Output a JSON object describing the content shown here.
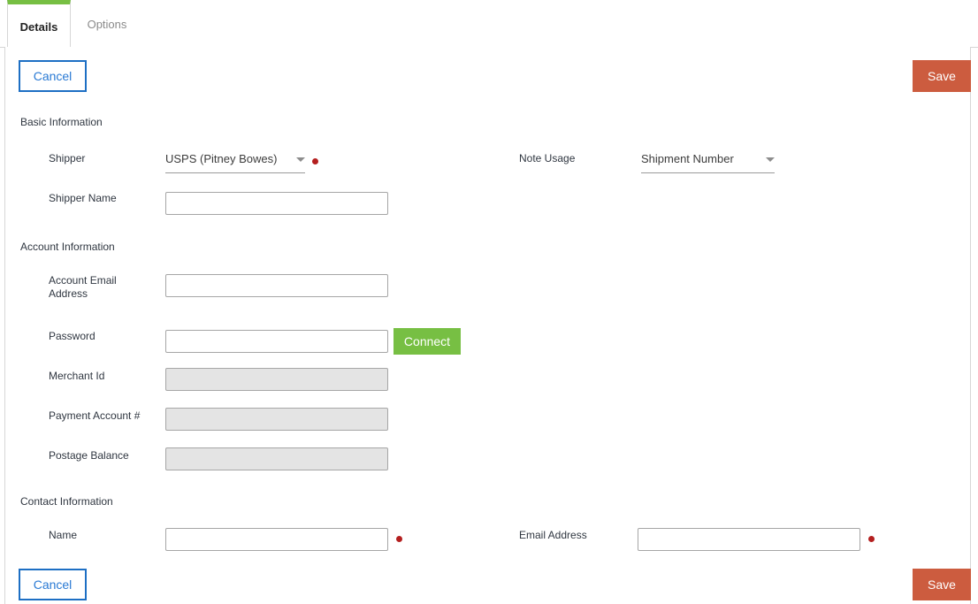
{
  "tabs": [
    {
      "label": "Details",
      "active": true
    },
    {
      "label": "Options",
      "active": false
    }
  ],
  "toolbar": {
    "cancel_label": "Cancel",
    "save_label": "Save"
  },
  "colors": {
    "accent_green": "#77bf43",
    "save_button": "#cc5c3f",
    "cancel_border": "#1d6fc4",
    "cancel_text": "#2a7ad4",
    "required_dot": "#b41f1f",
    "label_text": "#2f3640",
    "panel_border": "#d6d6d6",
    "input_border": "#a6a6a6",
    "disabled_field": "#e4e4e4"
  },
  "sections": {
    "basic": {
      "heading": "Basic Information"
    },
    "account": {
      "heading": "Account Information"
    },
    "contact": {
      "heading": "Contact Information"
    }
  },
  "fields": {
    "shipper": {
      "label": "Shipper",
      "value": "USPS (Pitney Bowes)",
      "required": true,
      "control": "dropdown"
    },
    "note_usage": {
      "label": "Note Usage",
      "value": "Shipment Number",
      "required": false,
      "control": "dropdown"
    },
    "shipper_name": {
      "label": "Shipper Name",
      "value": "",
      "placeholder": "",
      "required": false,
      "control": "text"
    },
    "account_email": {
      "label": "Account Email Address",
      "value": "",
      "placeholder": "",
      "required": false,
      "control": "text"
    },
    "password": {
      "label": "Password",
      "value": "",
      "placeholder": "",
      "required": false,
      "control": "text"
    },
    "merchant_id": {
      "label": "Merchant Id",
      "value": "",
      "placeholder": "",
      "required": false,
      "disabled": true,
      "control": "text"
    },
    "payment_account": {
      "label": "Payment Account #",
      "value": "",
      "placeholder": "",
      "required": false,
      "disabled": true,
      "control": "text"
    },
    "postage_balance": {
      "label": "Postage Balance",
      "value": "",
      "placeholder": "",
      "required": false,
      "disabled": true,
      "control": "text"
    },
    "contact_name": {
      "label": "Name",
      "value": "",
      "placeholder": "",
      "required": true,
      "control": "text"
    },
    "contact_email": {
      "label": "Email Address",
      "value": "",
      "placeholder": "",
      "required": true,
      "control": "text"
    }
  },
  "buttons": {
    "connect": {
      "label": "Connect"
    }
  },
  "icons": {
    "caret_down": "chevron-down-icon",
    "required_marker": "required-dot-icon"
  }
}
